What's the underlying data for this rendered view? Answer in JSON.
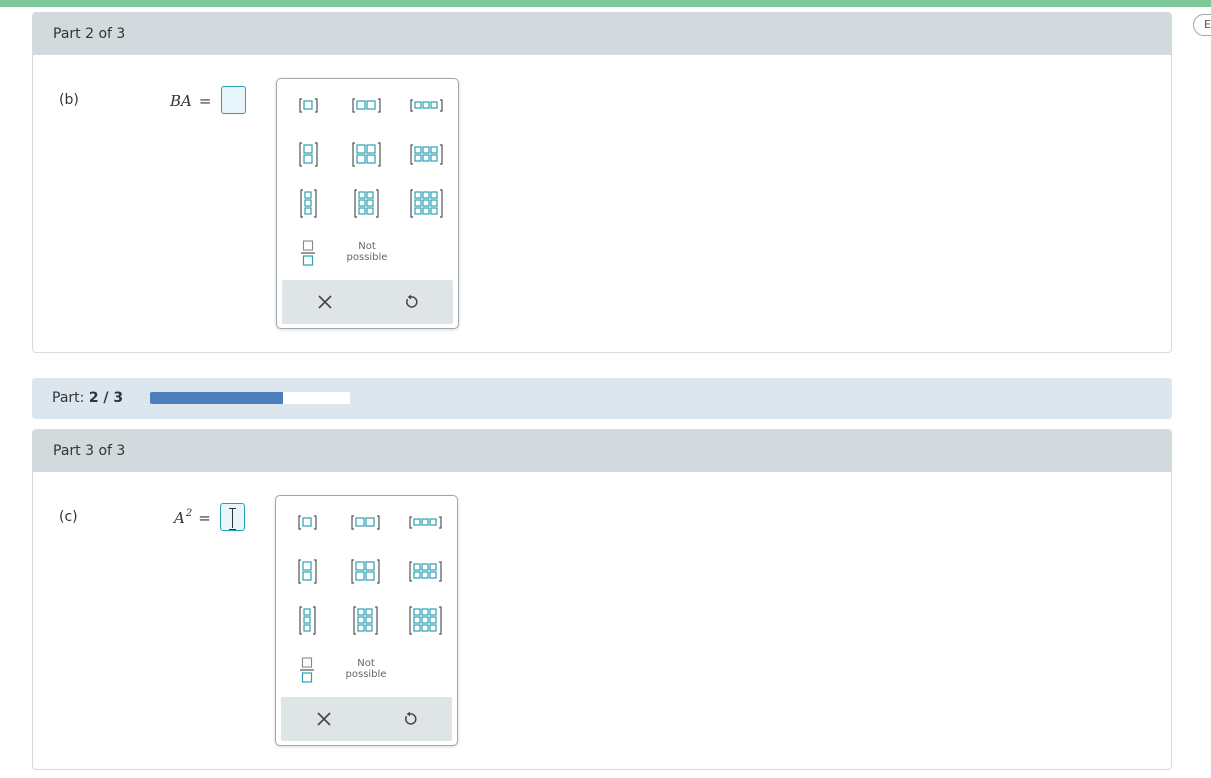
{
  "side_button": {
    "label": "Es"
  },
  "part_b": {
    "header": "Part 2 of 3",
    "label": "(b)",
    "expr_main": "BA",
    "expr_sup": "",
    "equals": "="
  },
  "part_c": {
    "header": "Part 3 of 3",
    "label": "(c)",
    "expr_main": "A",
    "expr_sup": "2",
    "equals": "="
  },
  "progress": {
    "label_prefix": "Part:",
    "value_text": "2 / 3",
    "current": 2,
    "total": 3,
    "fill_fraction": 0.667,
    "fill_color": "#4a7fbc"
  },
  "palette": {
    "not_possible_line1": "Not",
    "not_possible_line2": "possible",
    "accent_color": "#2aa0b5",
    "tools": [
      {
        "name": "matrix-1x1-button",
        "rows": 1,
        "cols": 1
      },
      {
        "name": "matrix-1x2-button",
        "rows": 1,
        "cols": 2
      },
      {
        "name": "matrix-1x3-button",
        "rows": 1,
        "cols": 3
      },
      {
        "name": "matrix-2x1-button",
        "rows": 2,
        "cols": 1
      },
      {
        "name": "matrix-2x2-button",
        "rows": 2,
        "cols": 2
      },
      {
        "name": "matrix-2x3-button",
        "rows": 2,
        "cols": 3
      },
      {
        "name": "matrix-3x1-button",
        "rows": 3,
        "cols": 1
      },
      {
        "name": "matrix-3x2-button",
        "rows": 3,
        "cols": 2
      },
      {
        "name": "matrix-3x3-button",
        "rows": 3,
        "cols": 3
      }
    ],
    "icons": {
      "fraction": "fraction-icon",
      "clear": "close-icon",
      "undo": "undo-icon"
    }
  }
}
